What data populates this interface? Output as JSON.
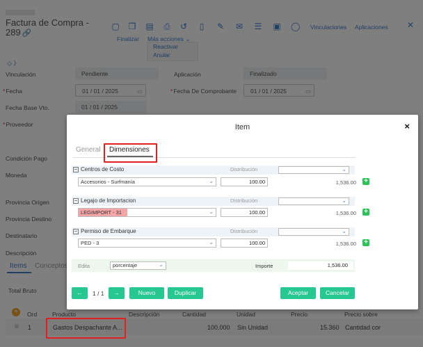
{
  "page": {
    "title_line1": "Factura de Compra -",
    "title_line2": "289",
    "toolbar": {
      "finalizar": "Finalizar",
      "mas_acciones": "Más acciones",
      "vinculaciones": "Vinculaciones",
      "aplicaciones": "Aplicaciones",
      "menu_items": [
        "Reactivar",
        "Anular"
      ]
    },
    "fields": {
      "vinculacion_label": "Vinculación",
      "vinculacion_value": "Pendiente",
      "aplicacion_label": "Aplicación",
      "aplicacion_value": "Finalizado",
      "fecha_label": "Fecha",
      "fecha_value": "01 / 01 / 2025",
      "fecha_comprobante_label": "Fecha De Comprobante",
      "fecha_comprobante_value": "01 / 01 / 2025",
      "fecha_base_label": "Fecha Base Vto.",
      "fecha_base_value": "01 / 01 / 2025",
      "proveedor_label": "Proveedor",
      "condicion_pago_label": "Condición Pago",
      "moneda_label": "Moneda",
      "provincia_origen_label": "Provincia Origen",
      "provincia_destino_label": "Provincia Destino",
      "destinatario_label": "Destinatario",
      "descripcion_label": "Descripción"
    },
    "tabs": [
      "Items",
      "Conceptos"
    ],
    "total_bruto_label": "Total Bruto",
    "grid": {
      "headers": [
        "Ord",
        "Producto",
        "Descripción",
        "Cantidad",
        "Unidad",
        "Precio",
        "Precio sobre"
      ],
      "row": {
        "ord": "1",
        "producto": "Gastos Despachante A...",
        "cantidad": "100.000",
        "unidad": "Sin Unidad",
        "precio": "15.360",
        "precio_sobre": "Cantidad cor"
      }
    }
  },
  "modal": {
    "title": "Item",
    "close": "×",
    "tabs": [
      "General",
      "Dimensiones"
    ],
    "distribucion_label": "Distribución",
    "sections": [
      {
        "title": "Centros de Costo",
        "selection": "Accesorios - Surfmanía",
        "distribution": "100.00",
        "amount": "1,536.00"
      },
      {
        "title": "Legajo de Importacion",
        "selection": "LEGIMPORT - 31",
        "distribution": "100.00",
        "amount": "1,536.00"
      },
      {
        "title": "Permiso de Embarque",
        "selection": "PED - 3",
        "distribution": "100.00",
        "amount": "1,536.00"
      }
    ],
    "edit_bar": {
      "label": "Edita",
      "mode": "porcentaje",
      "importe_label": "Importe",
      "importe_value": "1,536.00"
    },
    "pager": "1 / 1",
    "buttons": {
      "nuevo": "Nuevo",
      "duplicar": "Duplicar",
      "aceptar": "Aceptar",
      "cancelar": "Cancelar"
    }
  },
  "colors": {
    "accent_green": "#27c792",
    "link_blue": "#3d7cc9",
    "highlight_red": "#e0201f"
  }
}
